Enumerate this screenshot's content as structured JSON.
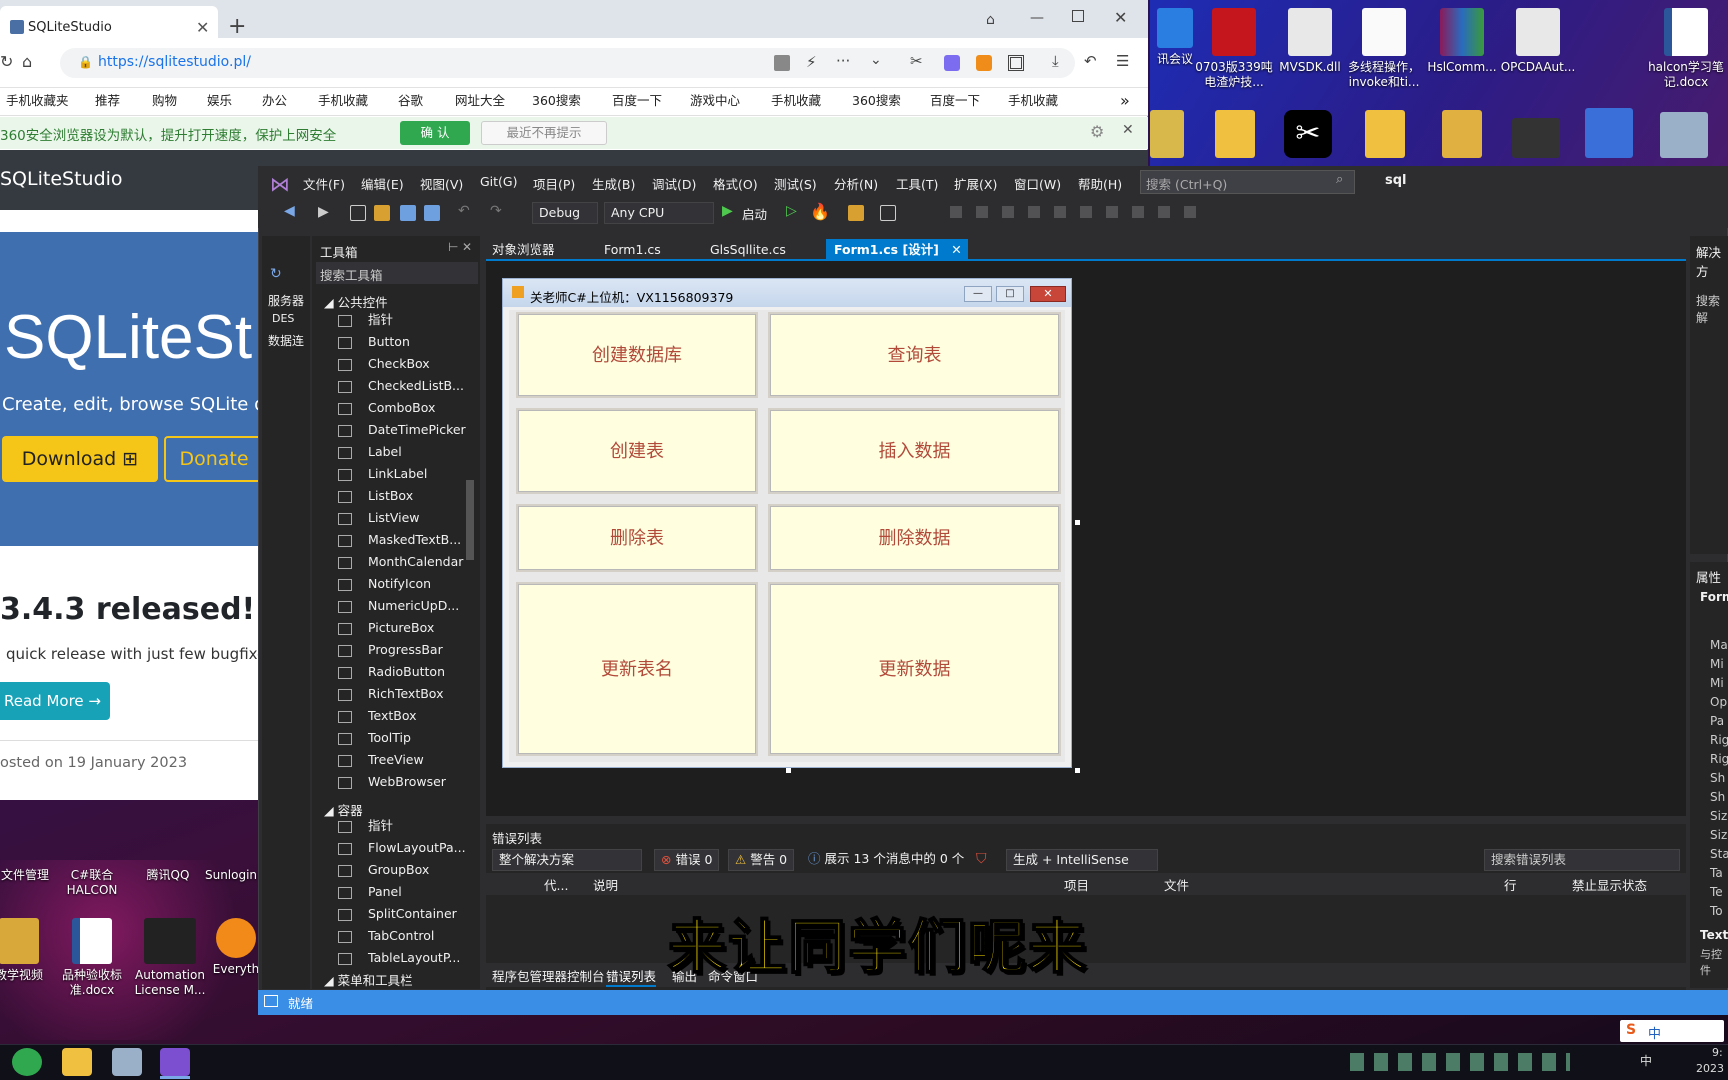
{
  "browser": {
    "tab_title": "SQLiteStudio",
    "url": "https://sqlitestudio.pl/",
    "bookmarks": [
      "手机收藏夹",
      "推荐",
      "购物",
      "娱乐",
      "办公",
      "手机收藏",
      "谷歌",
      "网址大全",
      "360搜索",
      "百度一下",
      "游戏中心",
      "手机收藏",
      "360搜索",
      "百度一下",
      "手机收藏"
    ],
    "notice": "360安全浏览器设为默认，提升打开速度，保护上网安全",
    "notice_ok": "确 认",
    "notice_no": "最近不再提示",
    "more": "»"
  },
  "site": {
    "brand": "SQLiteStudio",
    "hero_title": "SQLiteSt",
    "hero_sub": "Create, edit, browse SQLite dat",
    "download": "Download",
    "donate": "Donate",
    "release_title": "3.4.3 released!",
    "release_text": "quick release with just few bugfixes.",
    "read_more": "Read More →",
    "posted": "osted on 19 January 2023"
  },
  "vs": {
    "menu": [
      "文件(F)",
      "编辑(E)",
      "视图(V)",
      "Git(G)",
      "项目(P)",
      "生成(B)",
      "调试(D)",
      "格式(O)",
      "测试(S)",
      "分析(N)",
      "工具(T)",
      "扩展(X)",
      "窗口(W)",
      "帮助(H)"
    ],
    "search_placeholder": "搜索 (Ctrl+Q)",
    "solution_name": "sql",
    "config": "Debug",
    "platform": "Any CPU",
    "start": "启动",
    "server_panel": [
      "服务器",
      "DES",
      "数据连"
    ],
    "toolbox_title": "工具箱",
    "toolbox_search": "搜索工具箱",
    "toolbox_group1": "公共控件",
    "toolbox_items": [
      "指针",
      "Button",
      "CheckBox",
      "CheckedListB...",
      "ComboBox",
      "DateTimePicker",
      "Label",
      "LinkLabel",
      "ListBox",
      "ListView",
      "MaskedTextB...",
      "MonthCalendar",
      "NotifyIcon",
      "NumericUpD...",
      "PictureBox",
      "ProgressBar",
      "RadioButton",
      "RichTextBox",
      "TextBox",
      "ToolTip",
      "TreeView",
      "WebBrowser"
    ],
    "toolbox_group2": "容器",
    "toolbox_items2": [
      "指针",
      "FlowLayoutPa...",
      "GroupBox",
      "Panel",
      "SplitContainer",
      "TabControl",
      "TableLayoutP..."
    ],
    "toolbox_group3": "菜单和工具栏",
    "doc_tabs": [
      "对象浏览器",
      "Form1.cs",
      "GlsSqllite.cs",
      "Form1.cs [设计]"
    ],
    "form_title": "关老师C#上位机：VX1156809379",
    "form_buttons": [
      "创建数据库",
      "查询表",
      "创建表",
      "插入数据",
      "删除表",
      "删除数据",
      "更新表名",
      "更新数据"
    ],
    "err_title": "错误列表",
    "err_scope": "整个解决方案",
    "err_errors": "错误 0",
    "err_warnings": "警告 0",
    "err_messages": "展示 13 个消息中的 0 个",
    "err_build": "生成 + IntelliSense",
    "err_search": "搜索错误列表",
    "err_cols": [
      "代...",
      "说明",
      "项目",
      "文件",
      "行",
      "禁止显示状态"
    ],
    "bottom_tabs": [
      "程序包管理器控制台",
      "错误列表",
      "输出",
      "命令窗口"
    ],
    "status": "就绪",
    "right_panel_title": "解决方",
    "right_search": "搜索解",
    "props_title": "属性",
    "props_obj": "Form",
    "props_rows": [
      "Ma",
      "Mi",
      "Mi",
      "Op",
      "Pa",
      "Rig",
      "Rig",
      "Sh",
      "Sh",
      "Siz",
      "Siz",
      "Sta",
      "Ta",
      "Te",
      "To"
    ],
    "props_text": "Text",
    "props_desc": "与控件"
  },
  "desktop": {
    "icons_top": [
      "讯会议",
      "0703版339吨电渣炉技...",
      "MVSDK.dll",
      "多线程操作，invoke和ti...",
      "HslComm...",
      "OPCDAAut...",
      "halcon学习笔记.docx"
    ],
    "icons_bottom_labels": [
      "文件管理",
      "C#联合HALCON",
      "腾讯QQ",
      "Sunlogin"
    ],
    "icons_bottom2": [
      "教学视频",
      "品种验收标准.docx",
      "Automation License M...",
      "Everyth"
    ]
  },
  "taskbar": {
    "ime": "中",
    "time": "9:",
    "date": "2023"
  },
  "caption": "来让同学们呢来",
  "colors": {
    "vs_bg": "#2d2d30",
    "status_blue": "#3a8ee6",
    "form_button_bg": "#ffffe0",
    "caption": "#ffe300"
  }
}
